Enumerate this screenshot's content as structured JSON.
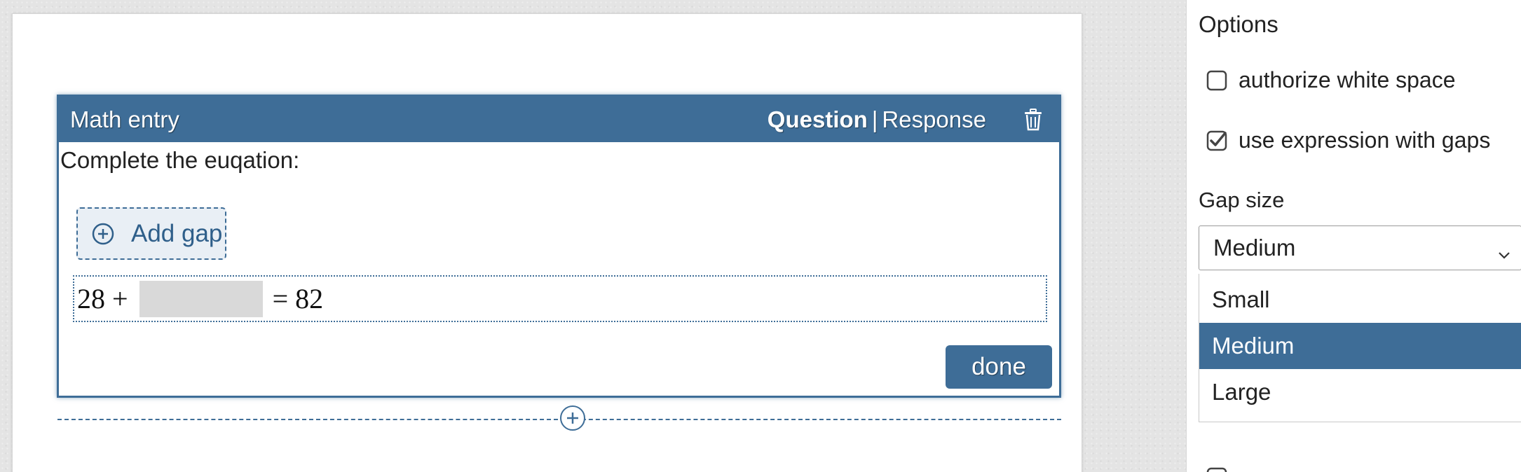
{
  "widget": {
    "title": "Math entry",
    "mode_question": "Question",
    "mode_separator": "|",
    "mode_response": "Response",
    "prompt": "Complete the euqation:",
    "add_gap_label": "Add gap",
    "expression_left": "28 +",
    "expression_right": "= 82",
    "done_label": "done"
  },
  "options": {
    "title": "Options",
    "checkboxes": [
      {
        "label": "authorize white space",
        "checked": false
      },
      {
        "label": "use expression with gaps",
        "checked": true
      }
    ],
    "gap_size_label": "Gap size",
    "gap_size_selected": "Medium",
    "gap_size_options": [
      "Small",
      "Medium",
      "Large"
    ]
  },
  "colors": {
    "accent": "#3e6d97",
    "gap_fill": "#d9d9d9"
  },
  "icons": {
    "delete": "trash-icon",
    "add_gap": "plus-circle-icon",
    "insert": "plus-circle-icon",
    "select": "chevron-down-icon"
  }
}
